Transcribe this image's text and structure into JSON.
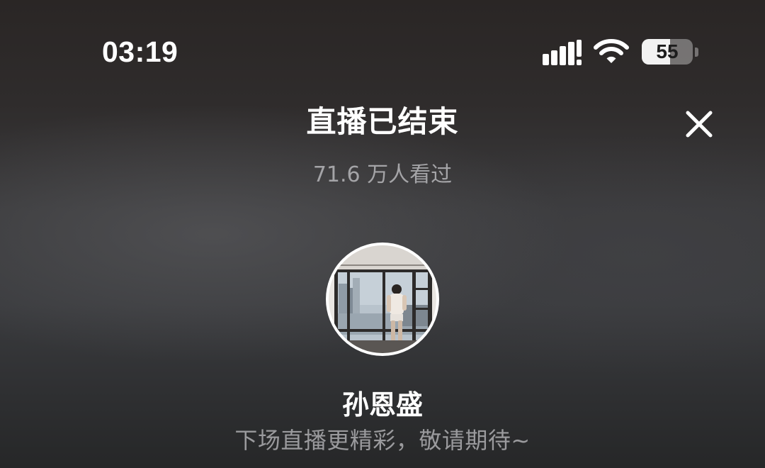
{
  "status_bar": {
    "time": "03:19",
    "battery_level": "55",
    "battery_fraction": 0.55,
    "signal_icon": "cellular-signal-icon",
    "wifi_icon": "wifi-icon"
  },
  "header": {
    "title": "直播已结束",
    "close_icon": "close-icon"
  },
  "stats": {
    "viewers": "71.6 万人看过"
  },
  "streamer": {
    "name": "孙恩盛",
    "avatar_icon": "avatar-photo",
    "message": "下场直播更精彩，敬请期待~"
  },
  "colors": {
    "text_primary": "#ffffff",
    "text_secondary": "#a4a4a7",
    "text_tertiary": "#9a9a9d"
  }
}
